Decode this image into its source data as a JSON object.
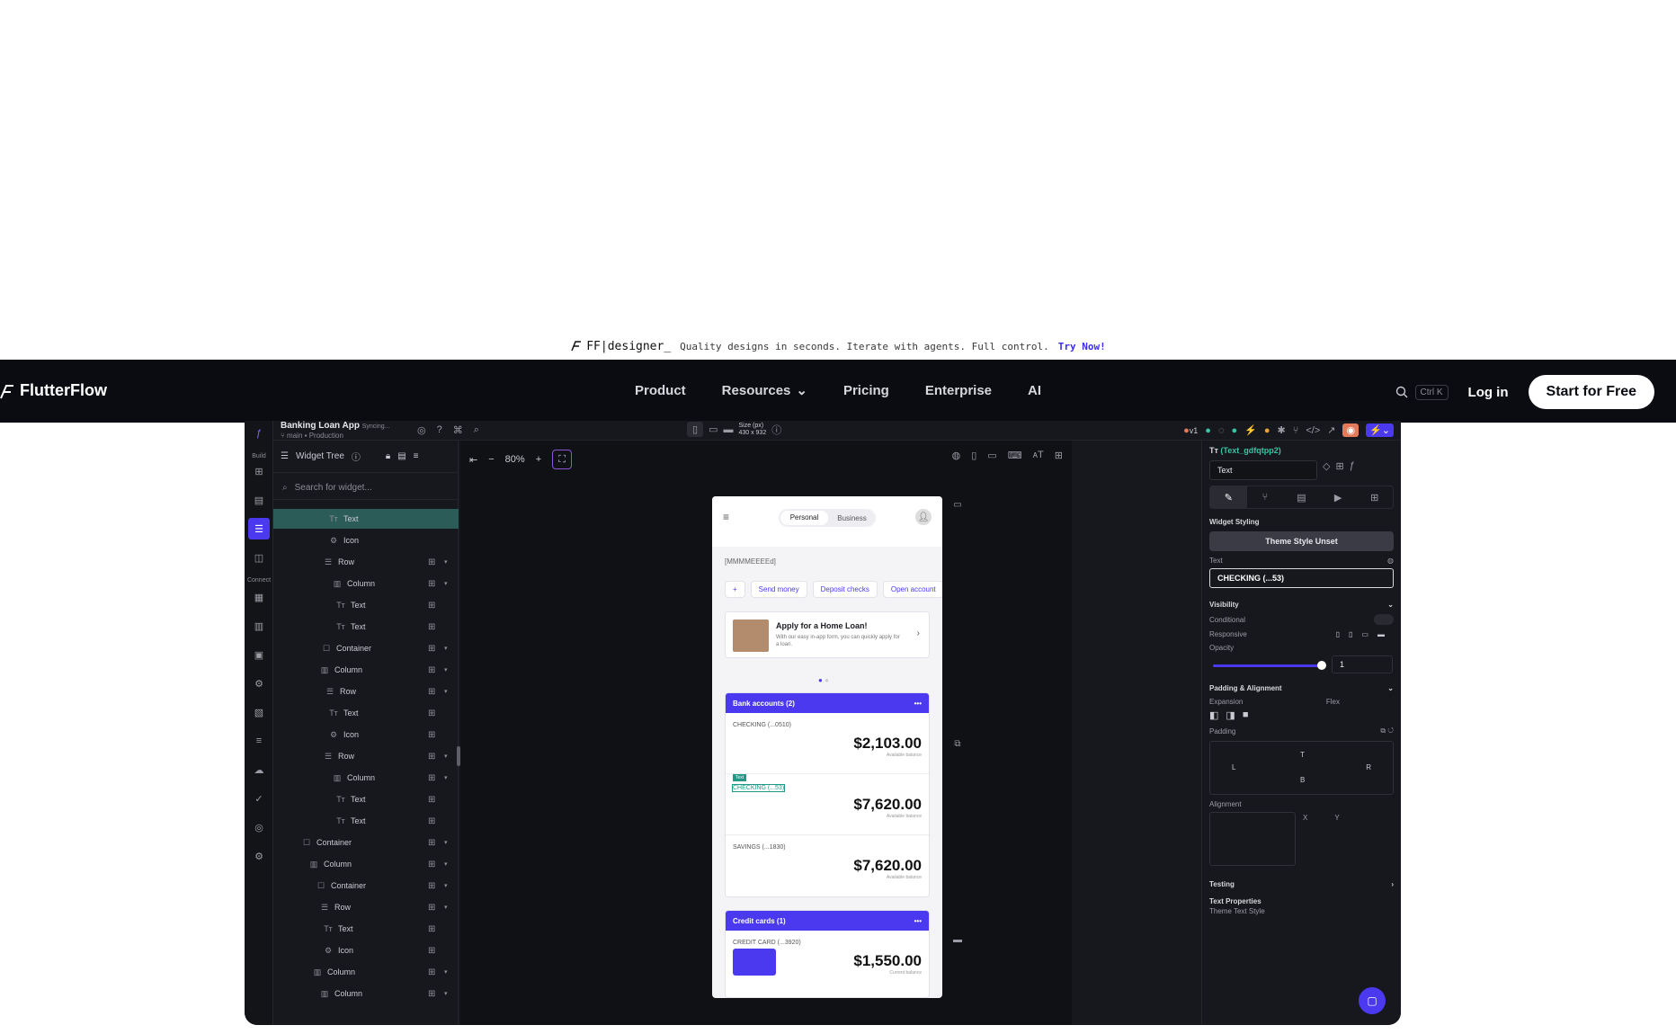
{
  "announcement": {
    "brand": "FF|designer_",
    "message": "Quality designs in seconds. Iterate with agents. Full control.",
    "cta": "Try Now!"
  },
  "nav": {
    "logo": "FlutterFlow",
    "menu": [
      "Product",
      "Resources",
      "Pricing",
      "Enterprise",
      "AI"
    ],
    "search_shortcut": "Ctrl K",
    "login": "Log in",
    "start": "Start for Free"
  },
  "app": {
    "project_name": "Banking Loan App",
    "project_status": "Syncing...",
    "branch": "main",
    "env": "Production",
    "rail_labels": [
      "Build",
      "Connect"
    ],
    "widget_tree_title": "Widget Tree",
    "search_placeholder": "Search for widget...",
    "tree_rows": [
      {
        "label": "Text",
        "icon": "text-icon"
      },
      {
        "label": "Icon",
        "icon": "icon-icon"
      },
      {
        "label": "Row",
        "icon": "row-icon"
      },
      {
        "label": "Column",
        "icon": "column-icon"
      },
      {
        "label": "Text",
        "icon": "text-icon"
      },
      {
        "label": "Text",
        "icon": "text-icon"
      },
      {
        "label": "Container",
        "icon": "container-icon"
      },
      {
        "label": "Column",
        "icon": "column-icon"
      },
      {
        "label": "Row",
        "icon": "row-icon"
      },
      {
        "label": "Text",
        "icon": "text-icon"
      },
      {
        "label": "Icon",
        "icon": "icon-icon"
      },
      {
        "label": "Row",
        "icon": "row-icon"
      },
      {
        "label": "Column",
        "icon": "column-icon"
      },
      {
        "label": "Text",
        "icon": "text-icon"
      },
      {
        "label": "Text",
        "icon": "text-icon"
      },
      {
        "label": "Container",
        "icon": "container-icon"
      },
      {
        "label": "Column",
        "icon": "column-icon"
      },
      {
        "label": "Container",
        "icon": "container-icon"
      },
      {
        "label": "Row",
        "icon": "row-icon"
      },
      {
        "label": "Text",
        "icon": "text-icon"
      },
      {
        "label": "Icon",
        "icon": "icon-icon"
      },
      {
        "label": "Column",
        "icon": "column-icon"
      },
      {
        "label": "Column",
        "icon": "column-icon"
      }
    ],
    "zoom": "80%",
    "device_size_label": "Size (px)",
    "device_size": "430 x 932",
    "version": "v1"
  },
  "phone": {
    "tabs": [
      "Personal",
      "Business"
    ],
    "date": "[MMMMEEEEd]",
    "chips": [
      "+",
      "Send money",
      "Deposit checks",
      "Open account"
    ],
    "promo_title": "Apply for a Home Loan!",
    "promo_sub": "With our easy in-app form, you can quickly apply for a loan.",
    "bank_header": "Bank accounts (2)",
    "accounts": [
      {
        "name": "CHECKING (...0510)",
        "amount": "$2,103.00",
        "label": "Available balance"
      },
      {
        "name": "CHECKING (...53)",
        "amount": "$7,620.00",
        "label": "Available balance"
      },
      {
        "name": "SAVINGS (...1830)",
        "amount": "$7,620.00",
        "label": "Available balance"
      }
    ],
    "selected_tag": "Text",
    "credit_header": "Credit cards (1)",
    "credit": {
      "name": "CREDIT CARD (...3920)",
      "amount": "$1,550.00",
      "label": "Current balance"
    }
  },
  "props": {
    "widget_id": "(Text_gdfqtpp2)",
    "widget_type": "Text",
    "widget_styling": "Widget Styling",
    "theme_style": "Theme Style Unset",
    "text_label": "Text",
    "text_value": "CHECKING (...53)",
    "visibility": "Visibility",
    "conditional": "Conditional",
    "responsive": "Responsive",
    "opacity": "Opacity",
    "opacity_value": "1",
    "padding_alignment": "Padding & Alignment",
    "expansion": "Expansion",
    "flex": "Flex",
    "padding": "Padding",
    "alignment": "Alignment",
    "pad_t": "T",
    "pad_l": "L",
    "pad_r": "R",
    "pad_b": "B",
    "x_label": "X",
    "y_label": "Y",
    "testing": "Testing",
    "text_properties": "Text Properties",
    "theme_text_style": "Theme Text Style"
  }
}
